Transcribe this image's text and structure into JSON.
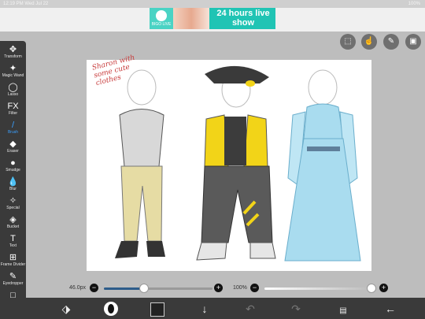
{
  "status": {
    "left": "12:19 PM   Wed Jul 22",
    "right": "100%"
  },
  "ad": {
    "logo_text": "BIGO LIVE",
    "headline": "24 hours live show"
  },
  "canvas": {
    "note": "Sharon with some cute clothes"
  },
  "tools": [
    {
      "label": "Transform",
      "icon": "✥"
    },
    {
      "label": "Magic Wand",
      "icon": "✦"
    },
    {
      "label": "Lasso",
      "icon": "◯"
    },
    {
      "label": "Filter",
      "icon": "FX"
    },
    {
      "label": "Brush",
      "icon": "/"
    },
    {
      "label": "Eraser",
      "icon": "◆"
    },
    {
      "label": "Smudge",
      "icon": "●"
    },
    {
      "label": "Blur",
      "icon": "💧"
    },
    {
      "label": "Special",
      "icon": "✧"
    },
    {
      "label": "Bucket",
      "icon": "◈"
    },
    {
      "label": "Text",
      "icon": "T"
    },
    {
      "label": "Frame Divider",
      "icon": "⊞"
    },
    {
      "label": "Eyedropper",
      "icon": "✎"
    },
    {
      "label": "Canvas",
      "icon": "□"
    }
  ],
  "active_tool": "Brush",
  "brush": {
    "size_label": "46.0px",
    "size_fraction": 0.37,
    "opacity_label": "100%",
    "opacity_fraction": 1.0
  },
  "colors": {
    "current": "#222222",
    "accent": "#3aa0ff"
  }
}
